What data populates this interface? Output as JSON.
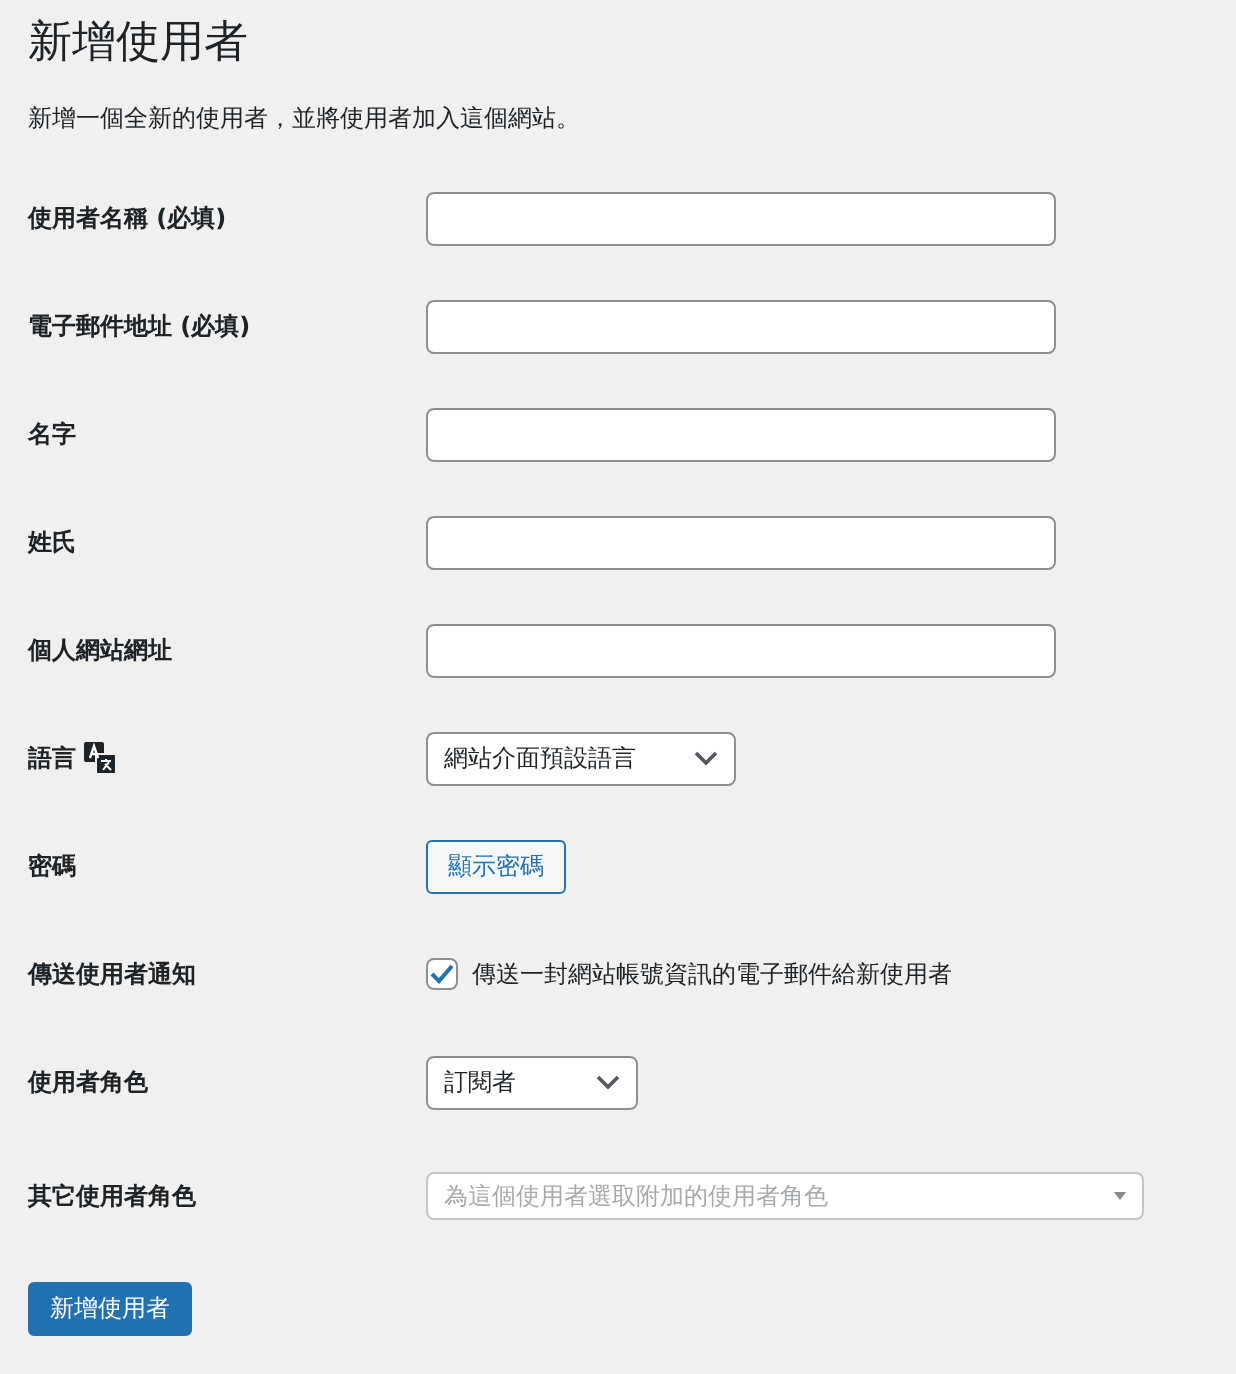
{
  "title": "新增使用者",
  "description": "新增一個全新的使用者，並將使用者加入這個網站。",
  "fields": [
    {
      "kind": "text",
      "label": "使用者名稱 (必填)"
    },
    {
      "kind": "text",
      "label": "電子郵件地址 (必填)"
    },
    {
      "kind": "text",
      "label": "名字"
    },
    {
      "kind": "text",
      "label": "姓氏"
    },
    {
      "kind": "text",
      "label": "個人網站網址"
    },
    {
      "kind": "select",
      "label": "語言",
      "translatable": true,
      "value": "網站介面預設語言"
    },
    {
      "kind": "button",
      "label": "密碼",
      "button": "顯示密碼"
    },
    {
      "kind": "checkbox",
      "label": "傳送使用者通知",
      "checked": true,
      "text": "傳送一封網站帳號資訊的電子郵件給新使用者"
    },
    {
      "kind": "select",
      "label": "使用者角色",
      "value": "訂閱者"
    },
    {
      "kind": "multiselect",
      "label": "其它使用者角色",
      "placeholder": "為這個使用者選取附加的使用者角色"
    }
  ],
  "submit": "新增使用者"
}
